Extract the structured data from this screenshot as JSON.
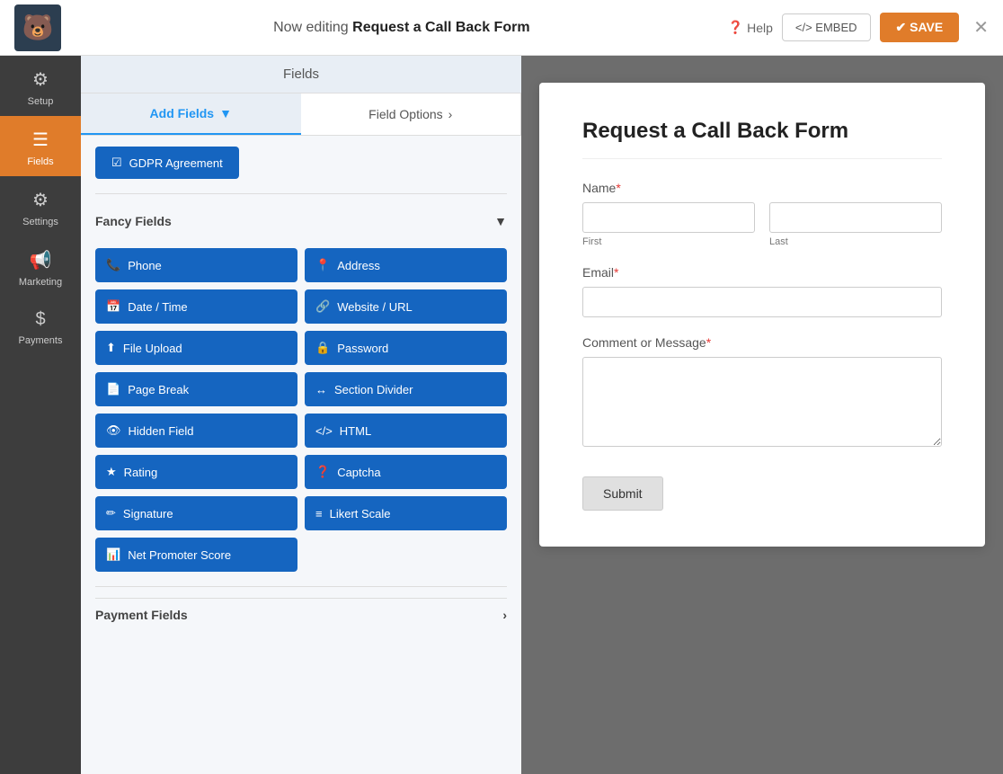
{
  "topbar": {
    "logo_emoji": "🐻",
    "editing_prefix": "Now editing",
    "form_name": "Request a Call Back Form",
    "help_label": "Help",
    "embed_label": "</> EMBED",
    "save_label": "✔ SAVE",
    "close_label": "✕"
  },
  "sidebar": {
    "items": [
      {
        "id": "setup",
        "label": "Setup",
        "icon": "⚙"
      },
      {
        "id": "fields",
        "label": "Fields",
        "icon": "☰",
        "active": true
      },
      {
        "id": "settings",
        "label": "Settings",
        "icon": "≡"
      },
      {
        "id": "marketing",
        "label": "Marketing",
        "icon": "📢"
      },
      {
        "id": "payments",
        "label": "Payments",
        "icon": "$"
      }
    ]
  },
  "fields_panel": {
    "header": "Fields",
    "tabs": [
      {
        "id": "add-fields",
        "label": "Add Fields",
        "active": true,
        "chevron": "▼"
      },
      {
        "id": "field-options",
        "label": "Field Options",
        "active": false,
        "chevron": "›"
      }
    ],
    "gdpr_button": "GDPR Agreement",
    "fancy_fields_section": "Fancy Fields",
    "fancy_fields": [
      {
        "id": "phone",
        "label": "Phone",
        "icon": "📞"
      },
      {
        "id": "address",
        "label": "Address",
        "icon": "📍"
      },
      {
        "id": "datetime",
        "label": "Date / Time",
        "icon": "📅"
      },
      {
        "id": "website",
        "label": "Website / URL",
        "icon": "🔗"
      },
      {
        "id": "file-upload",
        "label": "File Upload",
        "icon": "⬆"
      },
      {
        "id": "password",
        "label": "Password",
        "icon": "🔒"
      },
      {
        "id": "page-break",
        "label": "Page Break",
        "icon": "📄"
      },
      {
        "id": "section-divider",
        "label": "Section Divider",
        "icon": "↔"
      },
      {
        "id": "hidden-field",
        "label": "Hidden Field",
        "icon": "👁"
      },
      {
        "id": "html",
        "label": "HTML",
        "icon": "</>"
      },
      {
        "id": "rating",
        "label": "Rating",
        "icon": "★"
      },
      {
        "id": "captcha",
        "label": "Captcha",
        "icon": "❓"
      },
      {
        "id": "signature",
        "label": "Signature",
        "icon": "✏"
      },
      {
        "id": "likert-scale",
        "label": "Likert Scale",
        "icon": "≡≡"
      },
      {
        "id": "net-promoter-score",
        "label": "Net Promoter Score",
        "icon": "📊"
      }
    ],
    "payment_fields_section": "Payment Fields"
  },
  "form_preview": {
    "title": "Request a Call Back Form",
    "fields": [
      {
        "type": "name",
        "label": "Name",
        "required": true,
        "subfields": [
          {
            "placeholder": "",
            "sublabel": "First"
          },
          {
            "placeholder": "",
            "sublabel": "Last"
          }
        ]
      },
      {
        "type": "email",
        "label": "Email",
        "required": true
      },
      {
        "type": "textarea",
        "label": "Comment or Message",
        "required": true
      }
    ],
    "submit_label": "Submit"
  }
}
